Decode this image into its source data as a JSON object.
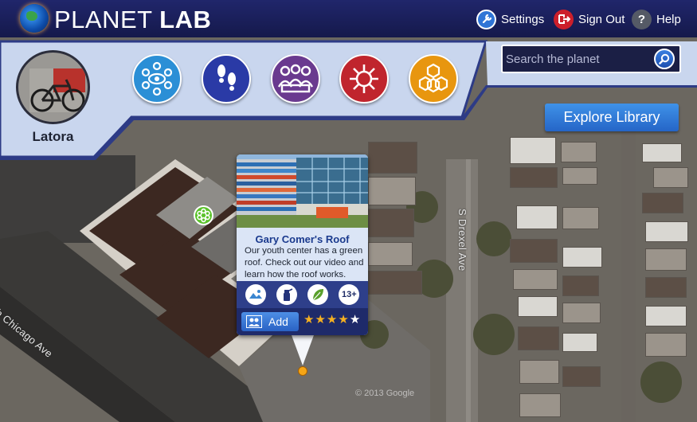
{
  "app": {
    "title_light": "PLANET",
    "title_bold": "LAB"
  },
  "header": {
    "settings_label": "Settings",
    "signout_label": "Sign Out",
    "help_label": "Help",
    "help_icon_glyph": "?"
  },
  "profile": {
    "name": "Latora"
  },
  "categories": [
    {
      "icon": "eye-network-icon",
      "color": "#2b8fd6"
    },
    {
      "icon": "footprints-icon",
      "color": "#2a3aa6"
    },
    {
      "icon": "group-reading-icon",
      "color": "#6a3a8f"
    },
    {
      "icon": "flower-ring-icon",
      "color": "#c0252d"
    },
    {
      "icon": "honeycomb-icon",
      "color": "#e8960f"
    }
  ],
  "search": {
    "placeholder": "Search the planet"
  },
  "library": {
    "explore_label": "Explore Library"
  },
  "map": {
    "street_vertical": "S Drexel Ave",
    "street_diagonal": "uth Chicago Ave",
    "copyright": "© 2013 Google"
  },
  "card": {
    "title": "Gary Comer's Roof",
    "description": "Our youth center has a green roof. Check out our video and learn how the roof works.",
    "age_badge": "13+",
    "badges": [
      "landscape-icon",
      "spray-bottle-icon",
      "leaf-icon"
    ],
    "add_label": "Add",
    "rating": 4,
    "rating_max": 5
  },
  "colors": {
    "header_bg": "#1a1f55",
    "band_bg": "#c9d6ee",
    "accent_blue": "#2a62c4"
  }
}
